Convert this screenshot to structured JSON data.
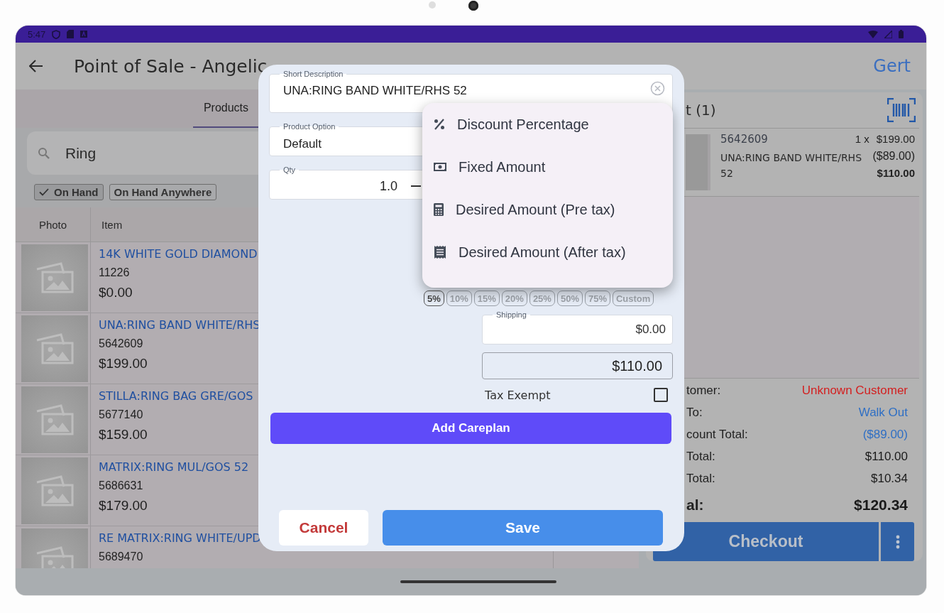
{
  "status_bar": {
    "time": "5:47"
  },
  "app_bar": {
    "title": "Point of Sale - Angelic",
    "user": "Gert"
  },
  "tabs": [
    {
      "label": "Products",
      "selected": true
    }
  ],
  "search": {
    "value": "Ring"
  },
  "filters": [
    {
      "label": "On Hand",
      "checked": true
    },
    {
      "label": "On Hand Anywhere",
      "checked": false
    }
  ],
  "table": {
    "columns": [
      "Photo",
      "Item"
    ],
    "rows": [
      {
        "name": "14K WHITE GOLD DIAMOND",
        "sku": "11226",
        "price": "$0.00"
      },
      {
        "name": "UNA:RING BAND WHITE/RHS",
        "sku": "5642609",
        "price": "$199.00"
      },
      {
        "name": "STILLA:RING BAG GRE/GOS",
        "sku": "5677140",
        "price": "$159.00"
      },
      {
        "name": "MATRIX:RING MUL/GOS 52",
        "sku": "5686631",
        "price": "$179.00"
      },
      {
        "name": "RE MATRIX:RING WHITE/UPD",
        "sku": "5689470"
      }
    ]
  },
  "cart": {
    "title": "t (1)",
    "items": [
      {
        "sku": "5642609",
        "quantity": "1 x",
        "price": "$199.00",
        "name": "UNA:RING BAND WHITE/RHS 52",
        "discount": "($89.00)",
        "total": "$110.00"
      }
    ],
    "summary": [
      {
        "label": "tomer:",
        "value": "Unknown Customer",
        "color": "#d32020",
        "kind": "plain"
      },
      {
        "label": "To:",
        "value": "Walk Out",
        "color": "#2f6fc4",
        "kind": "plain"
      },
      {
        "label": "count Total:",
        "value": "($89.00)",
        "color": "#2f6fc4",
        "kind": "plain"
      },
      {
        "label": "Total:",
        "value": "$110.00",
        "color": "#1a1a1a",
        "kind": "plain"
      },
      {
        "label": "Total:",
        "value": "$10.34",
        "color": "#1a1a1a",
        "kind": "plain"
      },
      {
        "label": "al:",
        "value": "$120.34",
        "color": "#1a1a1a",
        "kind": "total"
      }
    ],
    "checkout": "Checkout"
  },
  "dialog": {
    "short_description": {
      "label": "Short Description",
      "value": "UNA:RING BAND WHITE/RHS 52"
    },
    "product_option": {
      "label": "Product Option",
      "value": "Default"
    },
    "qty": {
      "label": "Qty",
      "value": "1.0"
    },
    "discount_menu": [
      {
        "label": "Discount Percentage",
        "kind": "percent"
      },
      {
        "label": "Fixed Amount",
        "kind": "cash"
      },
      {
        "label": "Desired Amount (Pre tax)",
        "kind": "calculator"
      },
      {
        "label": "Desired Amount (After tax)",
        "kind": "receipt"
      }
    ],
    "discount_chips": [
      {
        "label": "5%",
        "selected": true
      },
      {
        "label": "10%",
        "selected": false
      },
      {
        "label": "15%",
        "selected": false
      },
      {
        "label": "20%",
        "selected": false
      },
      {
        "label": "25%",
        "selected": false
      },
      {
        "label": "50%",
        "selected": false
      },
      {
        "label": "75%",
        "selected": false
      },
      {
        "label": "Custom",
        "selected": false
      }
    ],
    "shipping": {
      "label": "Shipping",
      "value": "$0.00"
    },
    "line_total": "$110.00",
    "tax_exempt": {
      "label": "Tax Exempt",
      "checked": false
    },
    "careplan_button": "Add Careplan",
    "cancel_button": "Cancel",
    "save_button": "Save"
  }
}
